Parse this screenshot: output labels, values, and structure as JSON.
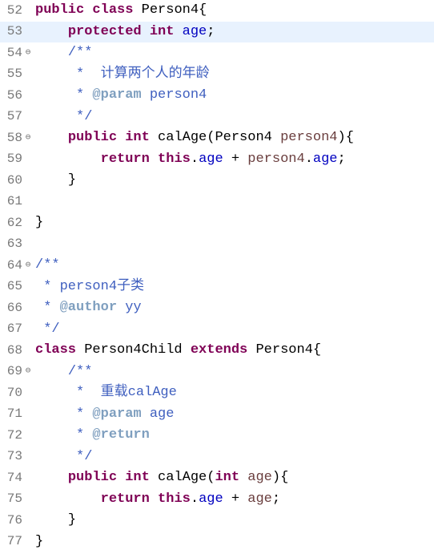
{
  "lines": [
    {
      "num": "52",
      "fold": "",
      "hl": false,
      "tokens": [
        {
          "cls": "kw",
          "t": "public"
        },
        {
          "cls": "plain",
          "t": " "
        },
        {
          "cls": "kw",
          "t": "class"
        },
        {
          "cls": "plain",
          "t": " Person4{"
        }
      ]
    },
    {
      "num": "53",
      "fold": "",
      "hl": true,
      "indent": "    ",
      "tokens": [
        {
          "cls": "kw",
          "t": "protected"
        },
        {
          "cls": "plain",
          "t": " "
        },
        {
          "cls": "kw",
          "t": "int"
        },
        {
          "cls": "plain",
          "t": " "
        },
        {
          "cls": "field",
          "t": "age"
        },
        {
          "cls": "plain",
          "t": ";"
        }
      ]
    },
    {
      "num": "54",
      "fold": "⊖",
      "hl": false,
      "indent": "    ",
      "tokens": [
        {
          "cls": "comment",
          "t": "/**"
        }
      ]
    },
    {
      "num": "55",
      "fold": "",
      "hl": false,
      "indent": "     ",
      "tokens": [
        {
          "cls": "comment",
          "t": "*  计算两个人的年龄"
        }
      ]
    },
    {
      "num": "56",
      "fold": "",
      "hl": false,
      "indent": "     ",
      "tokens": [
        {
          "cls": "comment",
          "t": "* "
        },
        {
          "cls": "tag",
          "t": "@param"
        },
        {
          "cls": "comment",
          "t": " person4"
        }
      ]
    },
    {
      "num": "57",
      "fold": "",
      "hl": false,
      "indent": "     ",
      "tokens": [
        {
          "cls": "comment",
          "t": "*/"
        }
      ]
    },
    {
      "num": "58",
      "fold": "⊖",
      "hl": false,
      "indent": "    ",
      "tokens": [
        {
          "cls": "kw",
          "t": "public"
        },
        {
          "cls": "plain",
          "t": " "
        },
        {
          "cls": "kw",
          "t": "int"
        },
        {
          "cls": "plain",
          "t": " calAge(Person4 "
        },
        {
          "cls": "varparam",
          "t": "person4"
        },
        {
          "cls": "plain",
          "t": "){"
        }
      ]
    },
    {
      "num": "59",
      "fold": "",
      "hl": false,
      "indent": "        ",
      "tokens": [
        {
          "cls": "kw",
          "t": "return"
        },
        {
          "cls": "plain",
          "t": " "
        },
        {
          "cls": "kw",
          "t": "this"
        },
        {
          "cls": "plain",
          "t": "."
        },
        {
          "cls": "field",
          "t": "age"
        },
        {
          "cls": "plain",
          "t": " + "
        },
        {
          "cls": "varparam",
          "t": "person4"
        },
        {
          "cls": "plain",
          "t": "."
        },
        {
          "cls": "field",
          "t": "age"
        },
        {
          "cls": "plain",
          "t": ";"
        }
      ]
    },
    {
      "num": "60",
      "fold": "",
      "hl": false,
      "indent": "    ",
      "tokens": [
        {
          "cls": "plain",
          "t": "}"
        }
      ]
    },
    {
      "num": "61",
      "fold": "",
      "hl": false,
      "indent": "",
      "tokens": []
    },
    {
      "num": "62",
      "fold": "",
      "hl": false,
      "indent": "",
      "tokens": [
        {
          "cls": "plain",
          "t": "}"
        }
      ]
    },
    {
      "num": "63",
      "fold": "",
      "hl": false,
      "indent": "",
      "tokens": []
    },
    {
      "num": "64",
      "fold": "⊖",
      "hl": false,
      "indent": "",
      "tokens": [
        {
          "cls": "comment",
          "t": "/**"
        }
      ]
    },
    {
      "num": "65",
      "fold": "",
      "hl": false,
      "indent": " ",
      "tokens": [
        {
          "cls": "comment",
          "t": "* person4子类"
        }
      ]
    },
    {
      "num": "66",
      "fold": "",
      "hl": false,
      "indent": " ",
      "tokens": [
        {
          "cls": "comment",
          "t": "* "
        },
        {
          "cls": "tag",
          "t": "@author"
        },
        {
          "cls": "comment",
          "t": " yy"
        }
      ]
    },
    {
      "num": "67",
      "fold": "",
      "hl": false,
      "indent": " ",
      "tokens": [
        {
          "cls": "comment",
          "t": "*/"
        }
      ]
    },
    {
      "num": "68",
      "fold": "",
      "hl": false,
      "indent": "",
      "tokens": [
        {
          "cls": "kw",
          "t": "class"
        },
        {
          "cls": "plain",
          "t": " Person4Child "
        },
        {
          "cls": "kw",
          "t": "extends"
        },
        {
          "cls": "plain",
          "t": " Person4{"
        }
      ]
    },
    {
      "num": "69",
      "fold": "⊖",
      "hl": false,
      "indent": "    ",
      "tokens": [
        {
          "cls": "comment",
          "t": "/**"
        }
      ]
    },
    {
      "num": "70",
      "fold": "",
      "hl": false,
      "indent": "     ",
      "tokens": [
        {
          "cls": "comment",
          "t": "*  重载calAge"
        }
      ]
    },
    {
      "num": "71",
      "fold": "",
      "hl": false,
      "indent": "     ",
      "tokens": [
        {
          "cls": "comment",
          "t": "* "
        },
        {
          "cls": "tag",
          "t": "@param"
        },
        {
          "cls": "comment",
          "t": " age"
        }
      ]
    },
    {
      "num": "72",
      "fold": "",
      "hl": false,
      "indent": "     ",
      "tokens": [
        {
          "cls": "comment",
          "t": "* "
        },
        {
          "cls": "tag",
          "t": "@return"
        }
      ]
    },
    {
      "num": "73",
      "fold": "",
      "hl": false,
      "indent": "     ",
      "tokens": [
        {
          "cls": "comment",
          "t": "*/"
        }
      ]
    },
    {
      "num": "74",
      "fold": "",
      "hl": false,
      "indent": "    ",
      "tokens": [
        {
          "cls": "kw",
          "t": "public"
        },
        {
          "cls": "plain",
          "t": " "
        },
        {
          "cls": "kw",
          "t": "int"
        },
        {
          "cls": "plain",
          "t": " calAge("
        },
        {
          "cls": "kw",
          "t": "int"
        },
        {
          "cls": "plain",
          "t": " "
        },
        {
          "cls": "varparam",
          "t": "age"
        },
        {
          "cls": "plain",
          "t": "){"
        }
      ]
    },
    {
      "num": "75",
      "fold": "",
      "hl": false,
      "indent": "        ",
      "tokens": [
        {
          "cls": "kw",
          "t": "return"
        },
        {
          "cls": "plain",
          "t": " "
        },
        {
          "cls": "kw",
          "t": "this"
        },
        {
          "cls": "plain",
          "t": "."
        },
        {
          "cls": "field",
          "t": "age"
        },
        {
          "cls": "plain",
          "t": " + "
        },
        {
          "cls": "varparam",
          "t": "age"
        },
        {
          "cls": "plain",
          "t": ";"
        }
      ]
    },
    {
      "num": "76",
      "fold": "",
      "hl": false,
      "indent": "    ",
      "tokens": [
        {
          "cls": "plain",
          "t": "}"
        }
      ]
    },
    {
      "num": "77",
      "fold": "",
      "hl": false,
      "indent": "",
      "tokens": [
        {
          "cls": "plain",
          "t": "}"
        }
      ]
    }
  ]
}
